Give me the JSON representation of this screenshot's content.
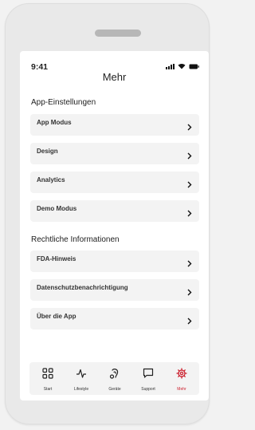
{
  "status_bar": {
    "time": "9:41"
  },
  "header": {
    "title": "Mehr"
  },
  "sections": [
    {
      "title": "App-Einstellungen",
      "items": [
        "App Modus",
        "Design",
        "Analytics",
        "Demo Modus"
      ]
    },
    {
      "title": "Rechtliche Informationen",
      "items": [
        "FDA-Hinweis",
        "Datenschutzbenachrichtigung",
        "Über die App"
      ]
    }
  ],
  "tabs": [
    {
      "label": "Start",
      "icon": "grid-icon"
    },
    {
      "label": "Lifestyle",
      "icon": "activity-icon"
    },
    {
      "label": "Geräte",
      "icon": "hearing-aid-icon"
    },
    {
      "label": "Support",
      "icon": "chat-icon"
    },
    {
      "label": "Mehr",
      "icon": "gear-icon"
    }
  ],
  "colors": {
    "accent": "#cc1f2d",
    "row_bg": "#f3f3f3",
    "frame": "#e9e9e9"
  }
}
